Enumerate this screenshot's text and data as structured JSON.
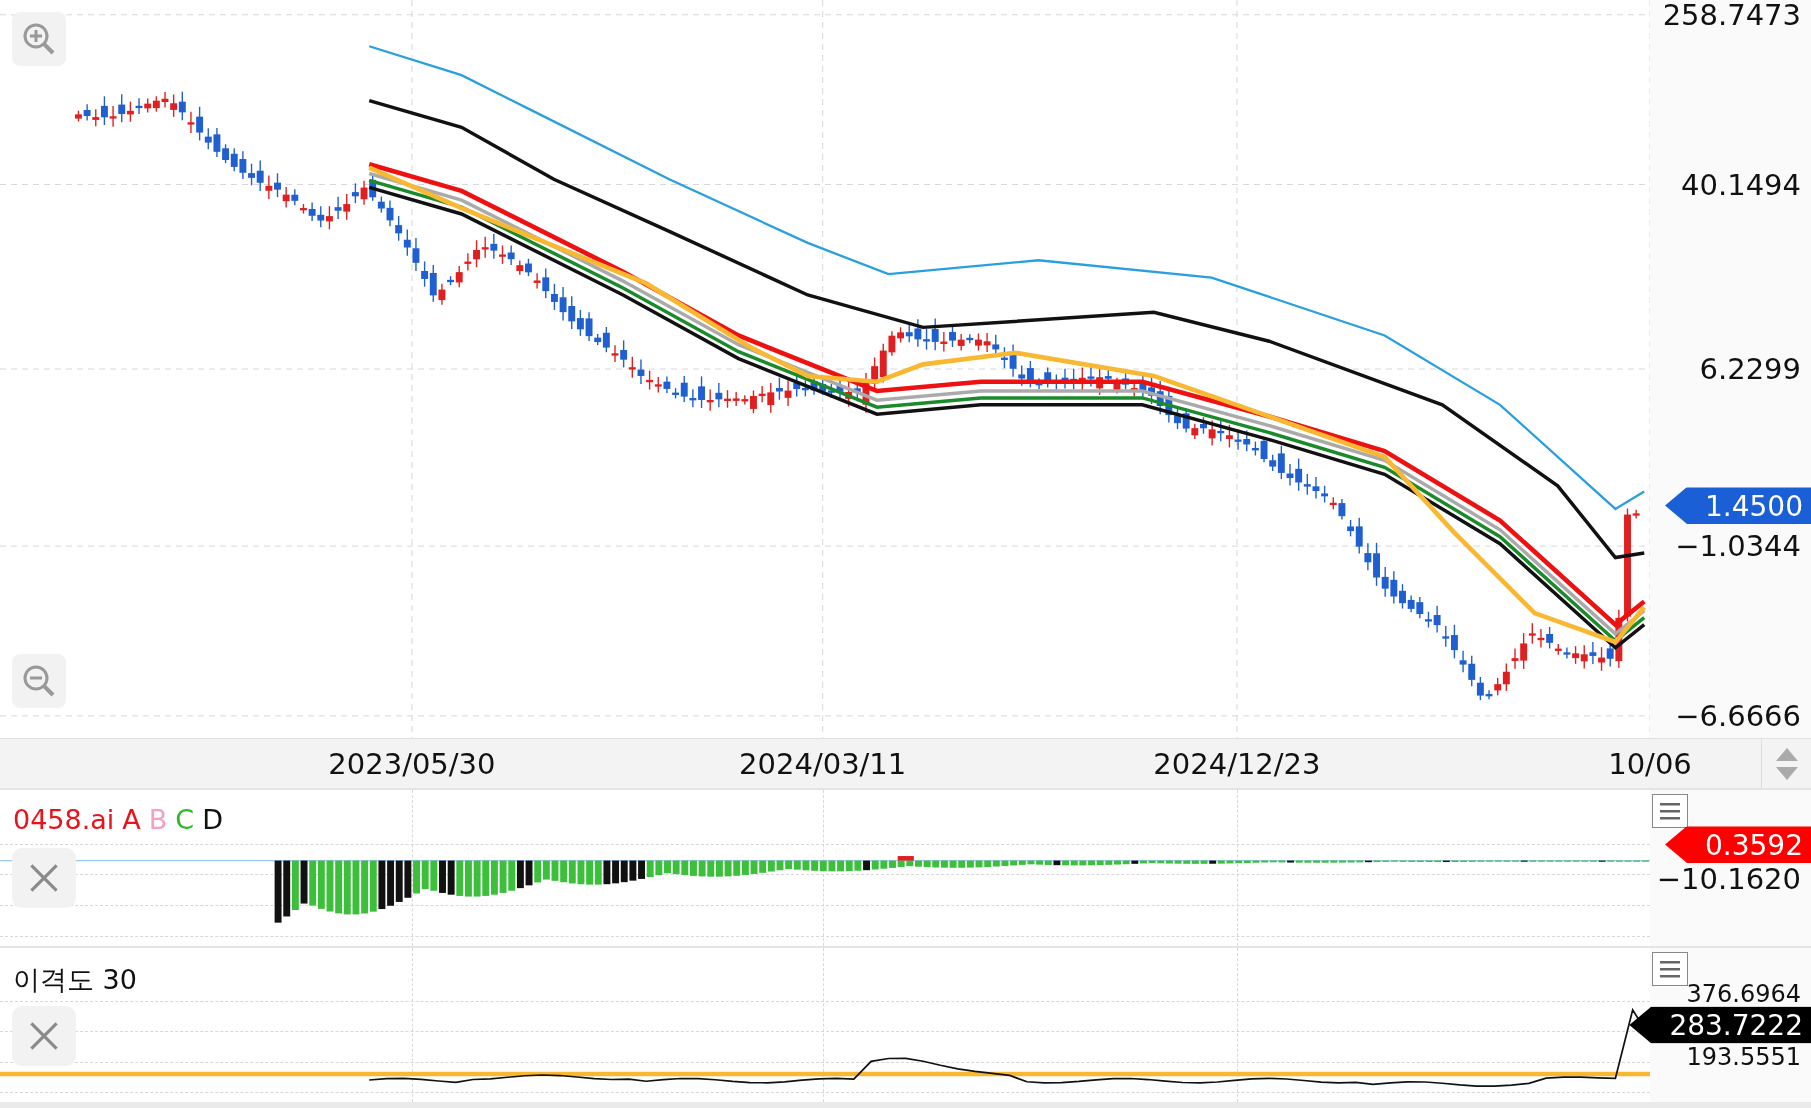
{
  "main_chart": {
    "price_axis": {
      "labels": [
        "258.7473",
        "40.1494",
        "6.2299",
        "−1.0344",
        "−6.6666"
      ]
    },
    "current_price": "1.4500"
  },
  "date_axis": {
    "labels": [
      "2023/05/30",
      "2024/03/11",
      "2024/12/23",
      "10/06"
    ]
  },
  "indicators": [
    {
      "kind": "histogram",
      "title_parts": [
        {
          "text": "0458.ai",
          "color": "#e8141b"
        },
        {
          "text": "A",
          "color": "#e8141b"
        },
        {
          "text": "B",
          "color": "#f4a0c8"
        },
        {
          "text": "C",
          "color": "#2db82d"
        },
        {
          "text": "D",
          "color": "#111111"
        }
      ],
      "axis_labels": [
        "−10.1620"
      ],
      "current_value": "0.3592"
    },
    {
      "kind": "line",
      "title": "이격도 30",
      "axis_labels": [
        "376.6964",
        "193.5551"
      ],
      "current_value": "283.7222"
    }
  ]
}
